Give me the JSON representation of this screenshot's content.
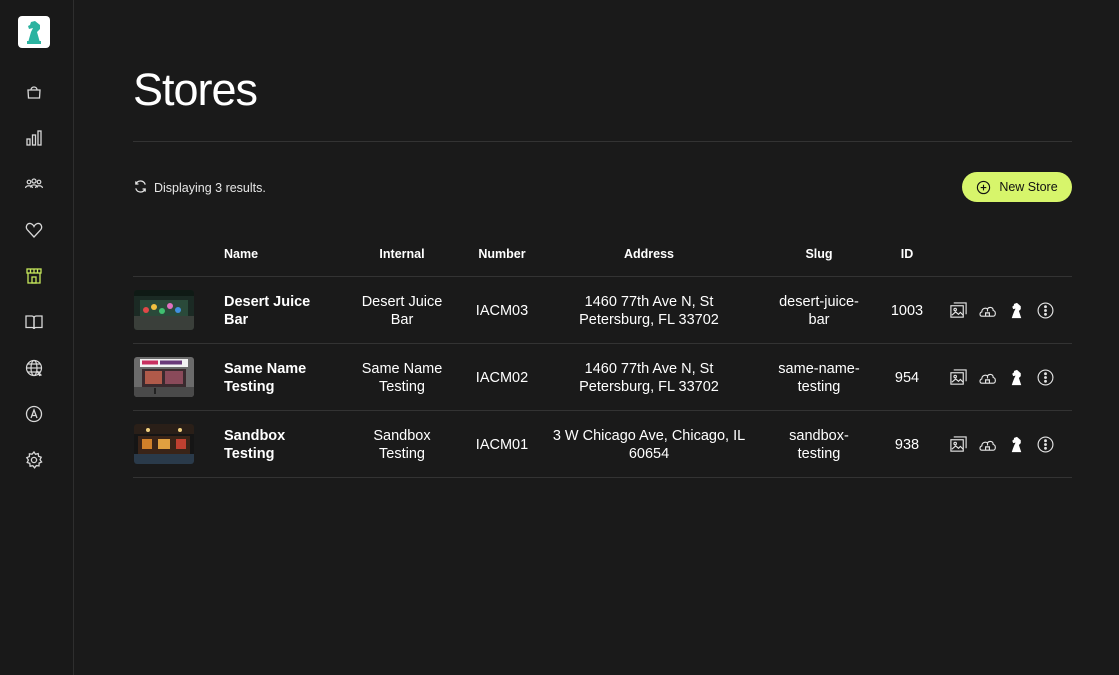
{
  "page": {
    "title": "Stores"
  },
  "sidebar": {
    "items": [
      {
        "id": "orders",
        "icon": "shopping-bag-icon"
      },
      {
        "id": "analytics",
        "icon": "bar-chart-icon"
      },
      {
        "id": "customers",
        "icon": "users-icon"
      },
      {
        "id": "loyalty",
        "icon": "heart-icon"
      },
      {
        "id": "stores",
        "icon": "storefront-icon",
        "active": true
      },
      {
        "id": "menu",
        "icon": "book-icon"
      },
      {
        "id": "web",
        "icon": "globe-icon"
      },
      {
        "id": "apps",
        "icon": "app-store-icon"
      },
      {
        "id": "settings",
        "icon": "gear-icon"
      }
    ]
  },
  "toolbar": {
    "status": "Displaying 3 results.",
    "new_store_label": "New Store"
  },
  "table": {
    "columns": {
      "name": "Name",
      "internal": "Internal",
      "number": "Number",
      "address": "Address",
      "slug": "Slug",
      "id": "ID"
    },
    "rows": [
      {
        "name": "Desert Juice Bar",
        "internal": "Desert Juice Bar",
        "number": "IACM03",
        "address": "1460 77th Ave N, St Petersburg, FL 33702",
        "slug": "desert-juice-bar",
        "id": "1003"
      },
      {
        "name": "Same Name Testing",
        "internal": "Same Name Testing",
        "number": "IACM02",
        "address": "1460 77th Ave N, St Petersburg, FL 33702",
        "slug": "same-name-testing",
        "id": "954"
      },
      {
        "name": "Sandbox Testing",
        "internal": "Sandbox Testing",
        "number": "IACM01",
        "address": "3 W Chicago Ave, Chicago, IL 60654",
        "slug": "sandbox-testing",
        "id": "938"
      }
    ]
  },
  "colors": {
    "accent": "#d7f56b",
    "active_nav": "#c6e85c",
    "background": "#1a1a1a",
    "logo": "#2bb3a0"
  }
}
